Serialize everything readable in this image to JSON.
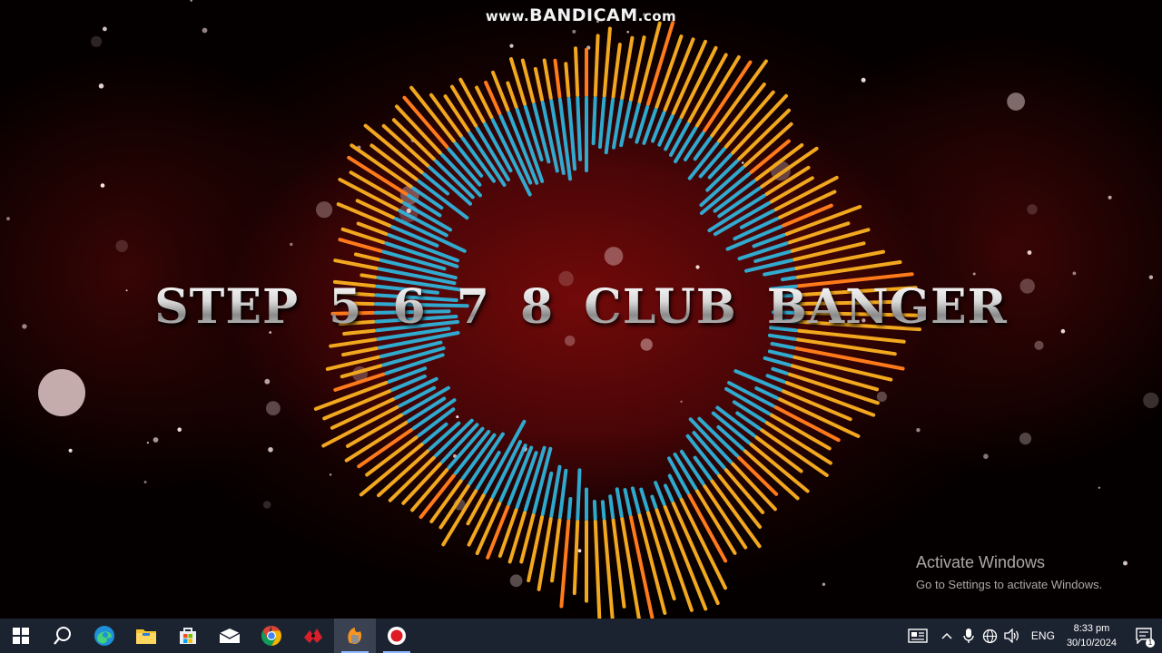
{
  "watermark": {
    "prefix": "www.",
    "brand": "BANDICAM",
    "suffix": ".com"
  },
  "video": {
    "title": "STEP 5 6 7 8 CLUB BANGER"
  },
  "activation": {
    "heading": "Activate Windows",
    "subtext": "Go to Settings to activate Windows."
  },
  "taskbar": {
    "apps": [
      {
        "name": "Start",
        "icon": "windows-logo-icon"
      },
      {
        "name": "Search",
        "icon": "search-icon"
      },
      {
        "name": "Microsoft Edge",
        "icon": "edge-icon"
      },
      {
        "name": "File Explorer",
        "icon": "folder-icon"
      },
      {
        "name": "Microsoft Store",
        "icon": "store-icon"
      },
      {
        "name": "Mail",
        "icon": "mail-icon"
      },
      {
        "name": "Google Chrome",
        "icon": "chrome-icon"
      },
      {
        "name": "Audio app",
        "icon": "audio-app-icon"
      },
      {
        "name": "FL Studio",
        "icon": "fl-studio-icon",
        "active": true
      },
      {
        "name": "Bandicam",
        "icon": "record-icon",
        "running": true
      }
    ],
    "tray": {
      "language": "ENG",
      "time": "8:33 pm",
      "date": "30/10/2024",
      "notification_count": "1"
    }
  },
  "colors": {
    "outer_bars": "#f2a81e",
    "inner_bars": "#2fb8e0",
    "background": "#7a0a0c",
    "taskbar": "#1c2330"
  }
}
